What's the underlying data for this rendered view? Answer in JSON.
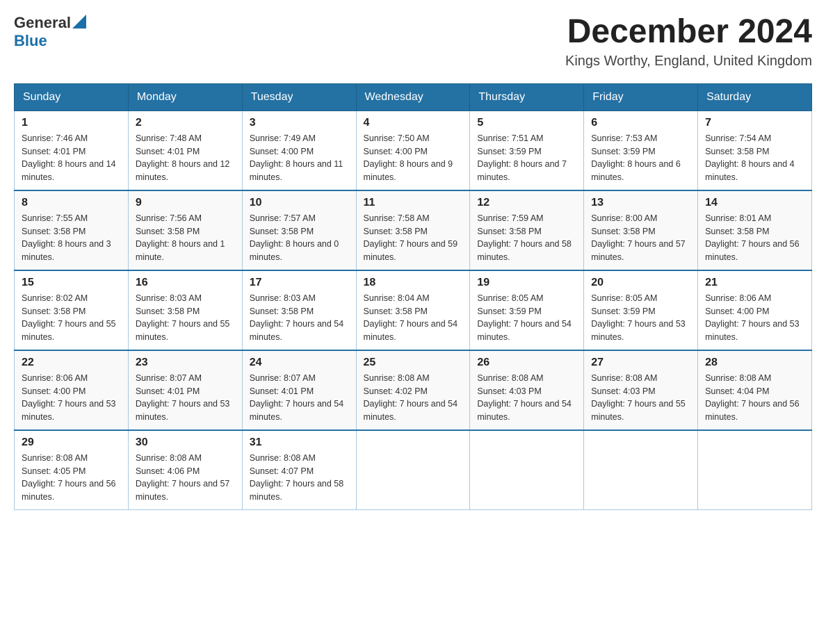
{
  "header": {
    "logo": {
      "general": "General",
      "blue": "Blue"
    },
    "title": "December 2024",
    "location": "Kings Worthy, England, United Kingdom"
  },
  "weekdays": [
    "Sunday",
    "Monday",
    "Tuesday",
    "Wednesday",
    "Thursday",
    "Friday",
    "Saturday"
  ],
  "weeks": [
    [
      {
        "day": "1",
        "sunrise": "7:46 AM",
        "sunset": "4:01 PM",
        "daylight": "8 hours and 14 minutes."
      },
      {
        "day": "2",
        "sunrise": "7:48 AM",
        "sunset": "4:01 PM",
        "daylight": "8 hours and 12 minutes."
      },
      {
        "day": "3",
        "sunrise": "7:49 AM",
        "sunset": "4:00 PM",
        "daylight": "8 hours and 11 minutes."
      },
      {
        "day": "4",
        "sunrise": "7:50 AM",
        "sunset": "4:00 PM",
        "daylight": "8 hours and 9 minutes."
      },
      {
        "day": "5",
        "sunrise": "7:51 AM",
        "sunset": "3:59 PM",
        "daylight": "8 hours and 7 minutes."
      },
      {
        "day": "6",
        "sunrise": "7:53 AM",
        "sunset": "3:59 PM",
        "daylight": "8 hours and 6 minutes."
      },
      {
        "day": "7",
        "sunrise": "7:54 AM",
        "sunset": "3:58 PM",
        "daylight": "8 hours and 4 minutes."
      }
    ],
    [
      {
        "day": "8",
        "sunrise": "7:55 AM",
        "sunset": "3:58 PM",
        "daylight": "8 hours and 3 minutes."
      },
      {
        "day": "9",
        "sunrise": "7:56 AM",
        "sunset": "3:58 PM",
        "daylight": "8 hours and 1 minute."
      },
      {
        "day": "10",
        "sunrise": "7:57 AM",
        "sunset": "3:58 PM",
        "daylight": "8 hours and 0 minutes."
      },
      {
        "day": "11",
        "sunrise": "7:58 AM",
        "sunset": "3:58 PM",
        "daylight": "7 hours and 59 minutes."
      },
      {
        "day": "12",
        "sunrise": "7:59 AM",
        "sunset": "3:58 PM",
        "daylight": "7 hours and 58 minutes."
      },
      {
        "day": "13",
        "sunrise": "8:00 AM",
        "sunset": "3:58 PM",
        "daylight": "7 hours and 57 minutes."
      },
      {
        "day": "14",
        "sunrise": "8:01 AM",
        "sunset": "3:58 PM",
        "daylight": "7 hours and 56 minutes."
      }
    ],
    [
      {
        "day": "15",
        "sunrise": "8:02 AM",
        "sunset": "3:58 PM",
        "daylight": "7 hours and 55 minutes."
      },
      {
        "day": "16",
        "sunrise": "8:03 AM",
        "sunset": "3:58 PM",
        "daylight": "7 hours and 55 minutes."
      },
      {
        "day": "17",
        "sunrise": "8:03 AM",
        "sunset": "3:58 PM",
        "daylight": "7 hours and 54 minutes."
      },
      {
        "day": "18",
        "sunrise": "8:04 AM",
        "sunset": "3:58 PM",
        "daylight": "7 hours and 54 minutes."
      },
      {
        "day": "19",
        "sunrise": "8:05 AM",
        "sunset": "3:59 PM",
        "daylight": "7 hours and 54 minutes."
      },
      {
        "day": "20",
        "sunrise": "8:05 AM",
        "sunset": "3:59 PM",
        "daylight": "7 hours and 53 minutes."
      },
      {
        "day": "21",
        "sunrise": "8:06 AM",
        "sunset": "4:00 PM",
        "daylight": "7 hours and 53 minutes."
      }
    ],
    [
      {
        "day": "22",
        "sunrise": "8:06 AM",
        "sunset": "4:00 PM",
        "daylight": "7 hours and 53 minutes."
      },
      {
        "day": "23",
        "sunrise": "8:07 AM",
        "sunset": "4:01 PM",
        "daylight": "7 hours and 53 minutes."
      },
      {
        "day": "24",
        "sunrise": "8:07 AM",
        "sunset": "4:01 PM",
        "daylight": "7 hours and 54 minutes."
      },
      {
        "day": "25",
        "sunrise": "8:08 AM",
        "sunset": "4:02 PM",
        "daylight": "7 hours and 54 minutes."
      },
      {
        "day": "26",
        "sunrise": "8:08 AM",
        "sunset": "4:03 PM",
        "daylight": "7 hours and 54 minutes."
      },
      {
        "day": "27",
        "sunrise": "8:08 AM",
        "sunset": "4:03 PM",
        "daylight": "7 hours and 55 minutes."
      },
      {
        "day": "28",
        "sunrise": "8:08 AM",
        "sunset": "4:04 PM",
        "daylight": "7 hours and 56 minutes."
      }
    ],
    [
      {
        "day": "29",
        "sunrise": "8:08 AM",
        "sunset": "4:05 PM",
        "daylight": "7 hours and 56 minutes."
      },
      {
        "day": "30",
        "sunrise": "8:08 AM",
        "sunset": "4:06 PM",
        "daylight": "7 hours and 57 minutes."
      },
      {
        "day": "31",
        "sunrise": "8:08 AM",
        "sunset": "4:07 PM",
        "daylight": "7 hours and 58 minutes."
      },
      null,
      null,
      null,
      null
    ]
  ]
}
